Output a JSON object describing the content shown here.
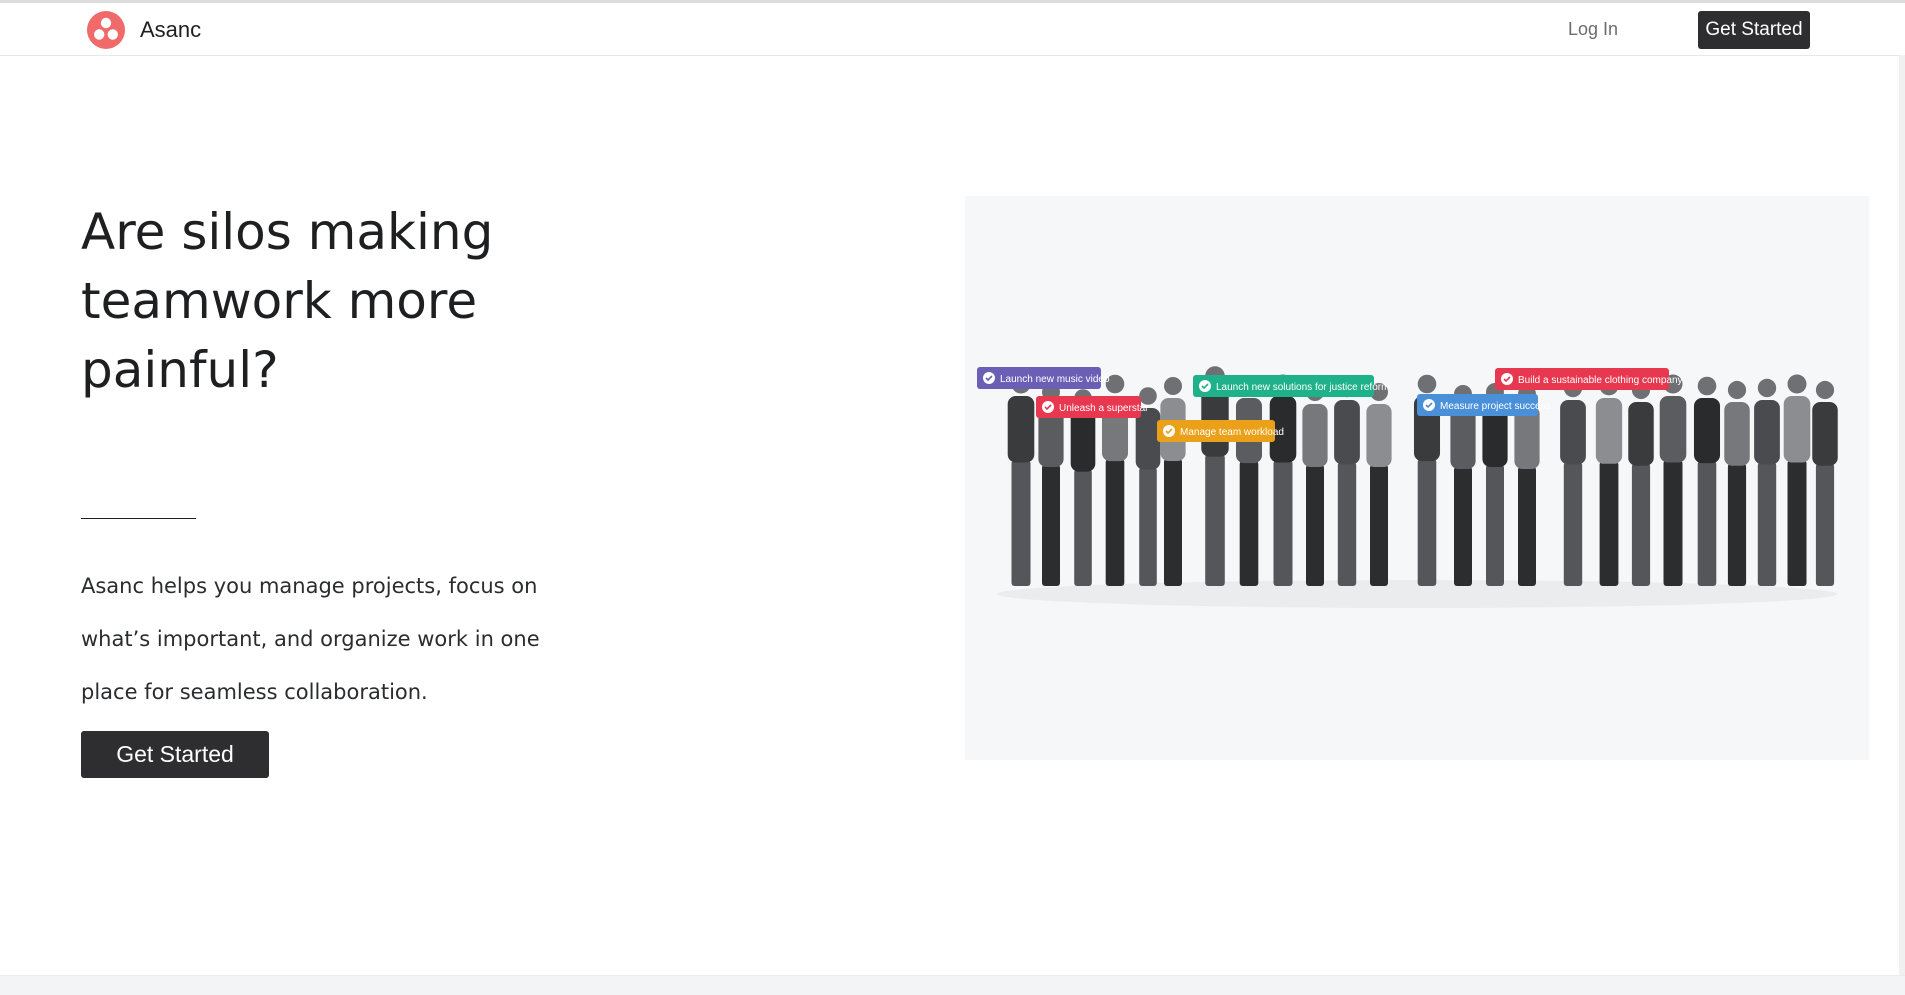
{
  "navbar": {
    "brand": "Asanc",
    "login_label": "Log In",
    "cta_label": "Get Started"
  },
  "hero": {
    "headline": "Are silos making teamwork more painful?",
    "description": "Asanc helps you manage projects, focus on what’s important, and organize work in one place for seamless collaboration.",
    "cta_label": "Get Started"
  },
  "image_tags": [
    {
      "label": "Launch new music video",
      "color": "#6b5fb5"
    },
    {
      "label": "Unleash a superstar",
      "color": "#e8384f"
    },
    {
      "label": "Manage team workload",
      "color": "#eaa019"
    },
    {
      "label": "Launch new solutions for justice reform",
      "color": "#1fb28a"
    },
    {
      "label": "Measure project success",
      "color": "#4a90d9"
    },
    {
      "label": "Build a sustainable clothing company",
      "color": "#e8384f"
    }
  ],
  "colors": {
    "brand_logo": "#f06a6a",
    "dark_button": "#2e2e30",
    "hero_image_bg": "#f6f7f8"
  },
  "icons": {
    "logo": "asanc-three-dots-logo",
    "tag_check": "check-circle-icon"
  }
}
